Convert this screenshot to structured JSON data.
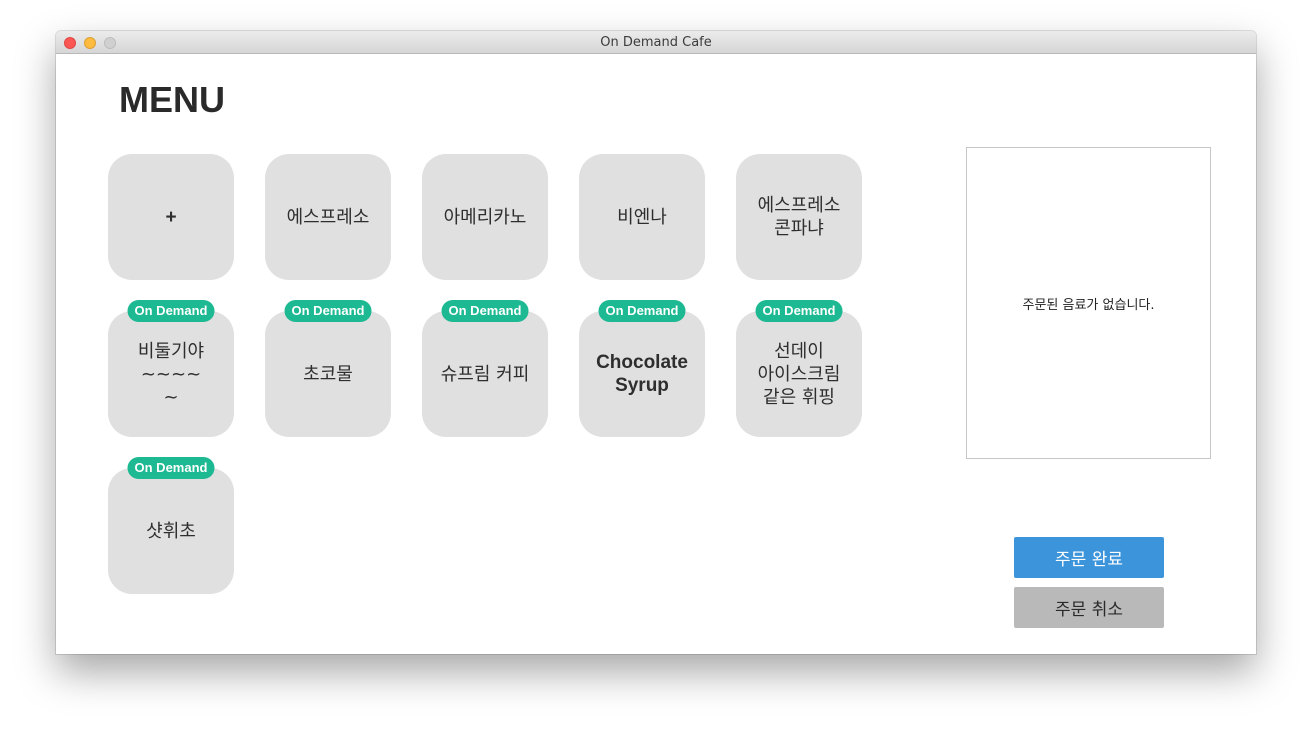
{
  "window": {
    "title": "On Demand Cafe"
  },
  "menu": {
    "heading": "MENU",
    "items": [
      {
        "label": "+",
        "bold": true,
        "badge": ""
      },
      {
        "label": "에스프레소",
        "badge": ""
      },
      {
        "label": "아메리카노",
        "badge": ""
      },
      {
        "label": "비엔나",
        "badge": ""
      },
      {
        "label": "에스프레소\n콘파냐",
        "badge": ""
      },
      {
        "label": "비둘기야~~~~\n~",
        "badge": "On Demand"
      },
      {
        "label": "초코물",
        "badge": "On Demand"
      },
      {
        "label": "슈프림 커피",
        "badge": "On Demand"
      },
      {
        "label": "Chocolate\nSyrup",
        "bold": true,
        "badge": "On Demand"
      },
      {
        "label": "선데이\n아이스크림\n같은 휘핑",
        "badge": "On Demand"
      },
      {
        "label": "샷휘초",
        "badge": "On Demand"
      }
    ]
  },
  "order": {
    "empty_message": "주문된 음료가 없습니다.",
    "complete_label": "주문 완료",
    "cancel_label": "주문 취소"
  },
  "colors": {
    "badge": "#1db992",
    "complete_button": "#3c94da",
    "cancel_button": "#b9b9b9",
    "tile": "#e0e0e0"
  }
}
